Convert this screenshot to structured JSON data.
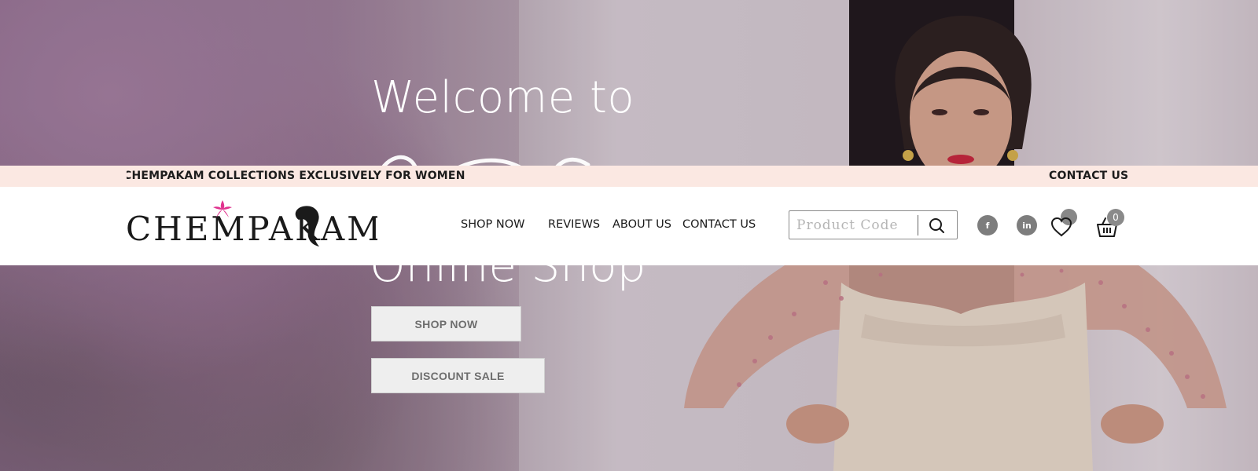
{
  "hero": {
    "title_line1": "Welcome to",
    "title_line3": "Online Shop",
    "shop_now_label": "SHOP NOW",
    "discount_label": "DISCOUNT SALE"
  },
  "announcement": {
    "left_text": "CHEMPAKAM COLLECTIONS EXCLUSIVELY FOR WOMEN",
    "right_text": "CONTACT US : F"
  },
  "header": {
    "logo_text": "CHEMPAKAM",
    "nav": [
      "SHOP NOW",
      "REVIEWS",
      "ABOUT US",
      "CONTACT US"
    ],
    "search_placeholder": "Product Code",
    "facebook_glyph": "f",
    "linkedin_glyph": "in",
    "cart_count": "0"
  },
  "colors": {
    "announcement_bg": "#fbe8e2",
    "badge": "#888888",
    "logo_flower": "#e0338f"
  },
  "icons": [
    "search-icon",
    "facebook-icon",
    "linkedin-icon",
    "heart-icon",
    "basket-icon",
    "flower-icon"
  ]
}
